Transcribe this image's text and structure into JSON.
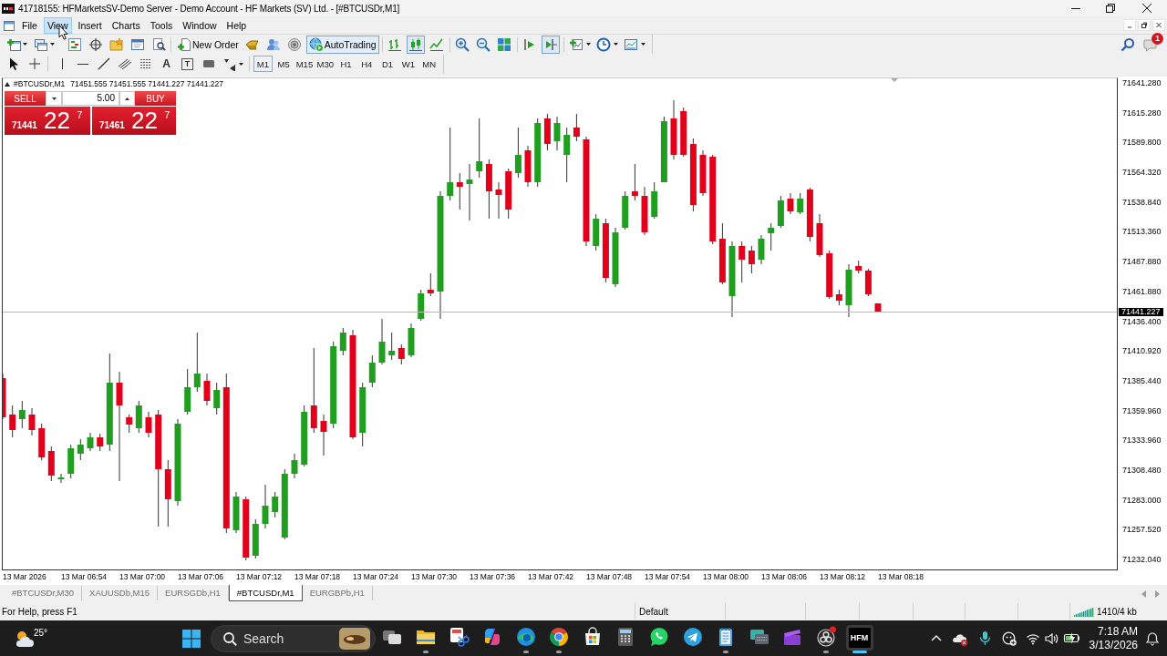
{
  "window": {
    "title": "41718155: HFMarketsSV-Demo Server - Demo Account - HF Markets (SV) Ltd. - [#BTCUSDr,M1]"
  },
  "menu": [
    {
      "label": "File",
      "selected": false
    },
    {
      "label": "View",
      "selected": true
    },
    {
      "label": "Insert",
      "selected": false
    },
    {
      "label": "Charts",
      "selected": false
    },
    {
      "label": "Tools",
      "selected": false
    },
    {
      "label": "Window",
      "selected": false
    },
    {
      "label": "Help",
      "selected": false
    }
  ],
  "toolbar": {
    "new_order": "New Order",
    "auto_trading": {
      "label": "AutoTrading",
      "on": true
    },
    "chart_types": [
      {
        "selected": false
      },
      {
        "selected": true
      },
      {
        "selected": false
      }
    ],
    "auto_scroll": {
      "on": false
    },
    "chart_shift": {
      "on": true
    },
    "notifications": "1"
  },
  "drawing_toolbar": {
    "text_tool": "A",
    "text_label_tool": "T"
  },
  "timeframes": [
    {
      "label": "M1",
      "selected": true
    },
    {
      "label": "M5",
      "selected": false
    },
    {
      "label": "M15",
      "selected": false
    },
    {
      "label": "M30",
      "selected": false
    },
    {
      "label": "H1",
      "selected": false
    },
    {
      "label": "H4",
      "selected": false
    },
    {
      "label": "D1",
      "selected": false
    },
    {
      "label": "W1",
      "selected": false
    },
    {
      "label": "MN",
      "selected": false
    }
  ],
  "chart": {
    "symbol": "#BTCUSDr,M1",
    "ohlc": "71451.555 71451.555 71441.227 71441.227",
    "one_click": {
      "sell": "SELL",
      "buy": "BUY",
      "lot": "5.00",
      "sell_price": "**71441** 22 $^{7}$",
      "buy_price": "**71461** 22 $^{7}$"
    },
    "price_axis": [
      "71641.280",
      "71615.280",
      "71589.800",
      "71564.320",
      "71538.840",
      "71513.360",
      "71487.880",
      "71461.880",
      "71436.400",
      "71410.920",
      "71385.440",
      "71359.960",
      "71333.960",
      "71308.480",
      "71283.000",
      "71257.520",
      "71232.040"
    ],
    "current_price": "71441.227",
    "time_axis": [
      "13 Mar 2026",
      "13 Mar 06:54",
      "13 Mar 07:00",
      "13 Mar 07:06",
      "13 Mar 07:12",
      "13 Mar 07:18",
      "13 Mar 07:24",
      "13 Mar 07:30",
      "13 Mar 07:36",
      "13 Mar 07:42",
      "13 Mar 07:48",
      "13 Mar 07:54",
      "13 Mar 08:00",
      "13 Mar 08:06",
      "13 Mar 08:12",
      "13 Mar 08:18"
    ]
  },
  "chart_tabs": [
    {
      "label": "#BTCUSDr,M30",
      "selected": false
    },
    {
      "label": "XAUUSDb,M15",
      "selected": false
    },
    {
      "label": "EURSGDb,H1",
      "selected": false
    },
    {
      "label": "#BTCUSDr,M1",
      "selected": true
    },
    {
      "label": "EURGBPb,H1",
      "selected": false
    }
  ],
  "status_bar": {
    "help": "For Help, press F1",
    "profile": "Default",
    "traffic": "1410/4 kb"
  },
  "taskbar": {
    "weather": "25°",
    "search": "Search",
    "apps": [
      {
        "running": false,
        "active": false
      },
      {
        "running": true,
        "active": false
      },
      {
        "running": false,
        "active": false
      },
      {
        "running": false,
        "active": false
      },
      {
        "running": true,
        "active": false
      },
      {
        "running": true,
        "active": false
      },
      {
        "running": false,
        "active": false
      },
      {
        "running": false,
        "active": false
      },
      {
        "running": false,
        "active": false
      },
      {
        "running": false,
        "active": false
      },
      {
        "running": true,
        "active": false
      },
      {
        "running": false,
        "active": false
      },
      {
        "running": false,
        "active": false
      },
      {
        "running": true,
        "active": false
      },
      {
        "label": "HFM",
        "running": true,
        "active": true
      }
    ],
    "time": "7:18 AM",
    "date": "3/13/2026"
  }
}
